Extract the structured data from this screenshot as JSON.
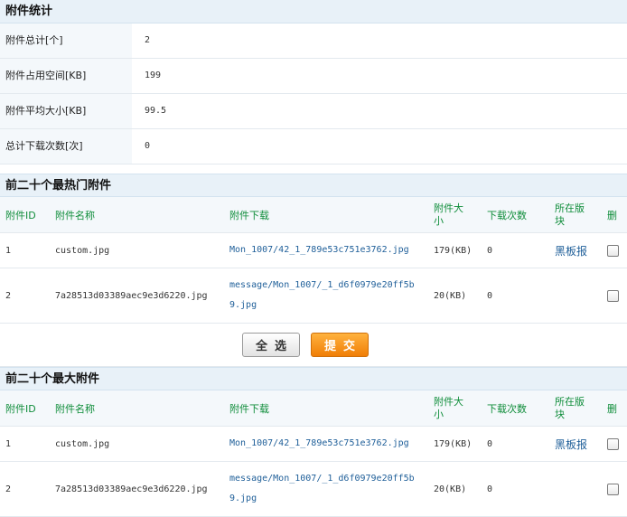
{
  "stats": {
    "title": "附件统计",
    "rows": [
      {
        "label": "附件总计[个]",
        "value": "2"
      },
      {
        "label": "附件占用空间[KB]",
        "value": "199"
      },
      {
        "label": "附件平均大小[KB]",
        "value": "99.5"
      },
      {
        "label": "总计下载次数[次]",
        "value": "0"
      }
    ]
  },
  "columns": {
    "id": "附件ID",
    "name": "附件名称",
    "download": "附件下载",
    "size": "附件大小",
    "count": "下载次数",
    "board": "所在版块",
    "del": "删"
  },
  "hot": {
    "title": "前二十个最热门附件",
    "rows": [
      {
        "id": "1",
        "name": "custom.jpg",
        "download": "Mon_1007/42_1_789e53c751e3762.jpg",
        "size": "179(KB)",
        "count": "0",
        "board": "黑板报"
      },
      {
        "id": "2",
        "name": "7a28513d03389aec9e3d6220.jpg",
        "download": "message/Mon_1007/_1_d6f0979e20ff5b9.jpg",
        "size": "20(KB)",
        "count": "0",
        "board": ""
      }
    ]
  },
  "buttons": {
    "select_all": "全选",
    "submit": "提交"
  },
  "largest": {
    "title": "前二十个最大附件",
    "rows": [
      {
        "id": "1",
        "name": "custom.jpg",
        "download": "Mon_1007/42_1_789e53c751e3762.jpg",
        "size": "179(KB)",
        "count": "0",
        "board": "黑板报"
      },
      {
        "id": "2",
        "name": "7a28513d03389aec9e3d6220.jpg",
        "download": "message/Mon_1007/_1_d6f0979e20ff5b9.jpg",
        "size": "20(KB)",
        "count": "0",
        "board": ""
      }
    ]
  }
}
